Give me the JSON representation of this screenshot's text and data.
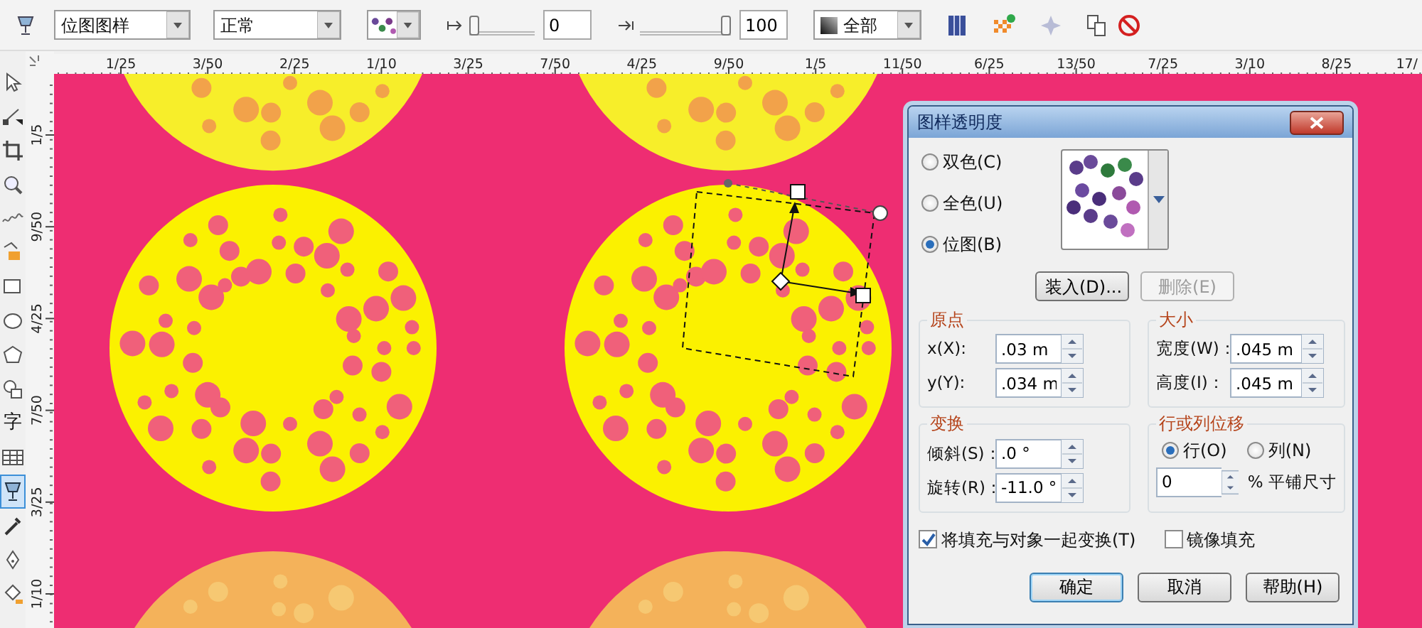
{
  "toolbar": {
    "fill_type": {
      "value": "位图图样"
    },
    "merge_mode": {
      "value": "正常"
    },
    "start_transparency": {
      "level": 0,
      "value": "0"
    },
    "end_transparency": {
      "level": 1,
      "value": "100"
    },
    "target": {
      "value": "全部"
    }
  },
  "tools": [
    {
      "kind": "pointer",
      "selected": false
    },
    {
      "kind": "shape",
      "selected": false
    },
    {
      "kind": "crop",
      "selected": false
    },
    {
      "kind": "zoom",
      "selected": false
    },
    {
      "kind": "freehand",
      "selected": false
    },
    {
      "kind": "smartfill",
      "selected": false
    },
    {
      "kind": "rectangle",
      "selected": false
    },
    {
      "kind": "ellipse",
      "selected": false
    },
    {
      "kind": "polygon",
      "selected": false
    },
    {
      "kind": "shapes",
      "selected": false
    },
    {
      "kind": "text",
      "label": "字",
      "selected": false
    },
    {
      "kind": "table",
      "selected": false
    },
    {
      "kind": "transparency",
      "selected": true
    },
    {
      "kind": "eyedropper",
      "selected": false
    },
    {
      "kind": "outline",
      "selected": false
    },
    {
      "kind": "fill",
      "selected": false
    }
  ],
  "rulers": {
    "horizontal": [
      "1/25",
      "3/50",
      "2/25",
      "1/10",
      "3/25",
      "7/50",
      "4/25",
      "9/50",
      "1/5",
      "11/50",
      "6/25",
      "13/50",
      "7/25",
      "3/10",
      "8/25",
      "17/"
    ],
    "vertical": [
      "1/5",
      "9/50",
      "4/25",
      "7/50",
      "3/25",
      "1/10"
    ]
  },
  "dialog": {
    "title": "图样透明度",
    "modes": [
      {
        "label": "双色(C)",
        "selected": false
      },
      {
        "label": "全色(U)",
        "selected": false
      },
      {
        "label": "位图(B)",
        "selected": true
      }
    ],
    "load_button": {
      "label": "装入(D)...",
      "disabled": false
    },
    "delete_button": {
      "label": "删除(E)",
      "disabled": true
    },
    "groups": [
      {
        "kind": "fields",
        "title": "原点",
        "fields": [
          {
            "label": "x(X):",
            "value": ".03 m"
          },
          {
            "label": "y(Y):",
            "value": ".034 m"
          }
        ]
      },
      {
        "kind": "fields",
        "title": "大小",
        "fields": [
          {
            "label": "宽度(W)：",
            "value": ".045 m"
          },
          {
            "label": "高度(I)：",
            "value": ".045 m"
          }
        ]
      },
      {
        "kind": "fields",
        "title": "变换",
        "fields": [
          {
            "label": "倾斜(S)：",
            "value": ".0 °"
          },
          {
            "label": "旋转(R)：",
            "value": "-11.0 °"
          }
        ]
      },
      {
        "kind": "offset",
        "title": "行或列位移",
        "axes": [
          {
            "label": "行(O)",
            "selected": true
          },
          {
            "label": "列(N)",
            "selected": false
          }
        ],
        "offset": {
          "value": "0",
          "unit": "% 平铺尺寸"
        }
      }
    ],
    "options": [
      {
        "label": "将填充与对象一起变换(T)",
        "checked": true
      },
      {
        "label": "镜像填充",
        "checked": false
      }
    ],
    "buttons": [
      {
        "label": "确定",
        "default": true
      },
      {
        "label": "取消",
        "default": false
      },
      {
        "label": "帮助(H)",
        "default": false
      }
    ]
  }
}
